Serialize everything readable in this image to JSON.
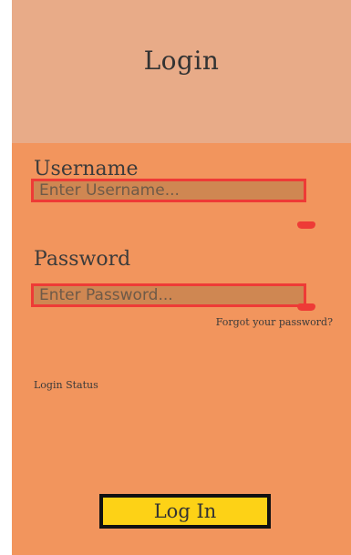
{
  "header": {
    "title": "Login"
  },
  "form": {
    "username_label": "Username",
    "username_placeholder": "Enter Username...",
    "username_value": "",
    "password_label": "Password",
    "password_placeholder": "Enter Password...",
    "password_value": "",
    "forgot_link": "Forgot your password?",
    "status_text": "Login Status",
    "submit_label": "Log In"
  },
  "colors": {
    "header_bg": "#e8ab88",
    "body_bg": "#f2955d",
    "input_border": "#ee3b36",
    "input_bg": "#cf8752",
    "button_bg": "#fdd216",
    "button_border": "#111111"
  }
}
